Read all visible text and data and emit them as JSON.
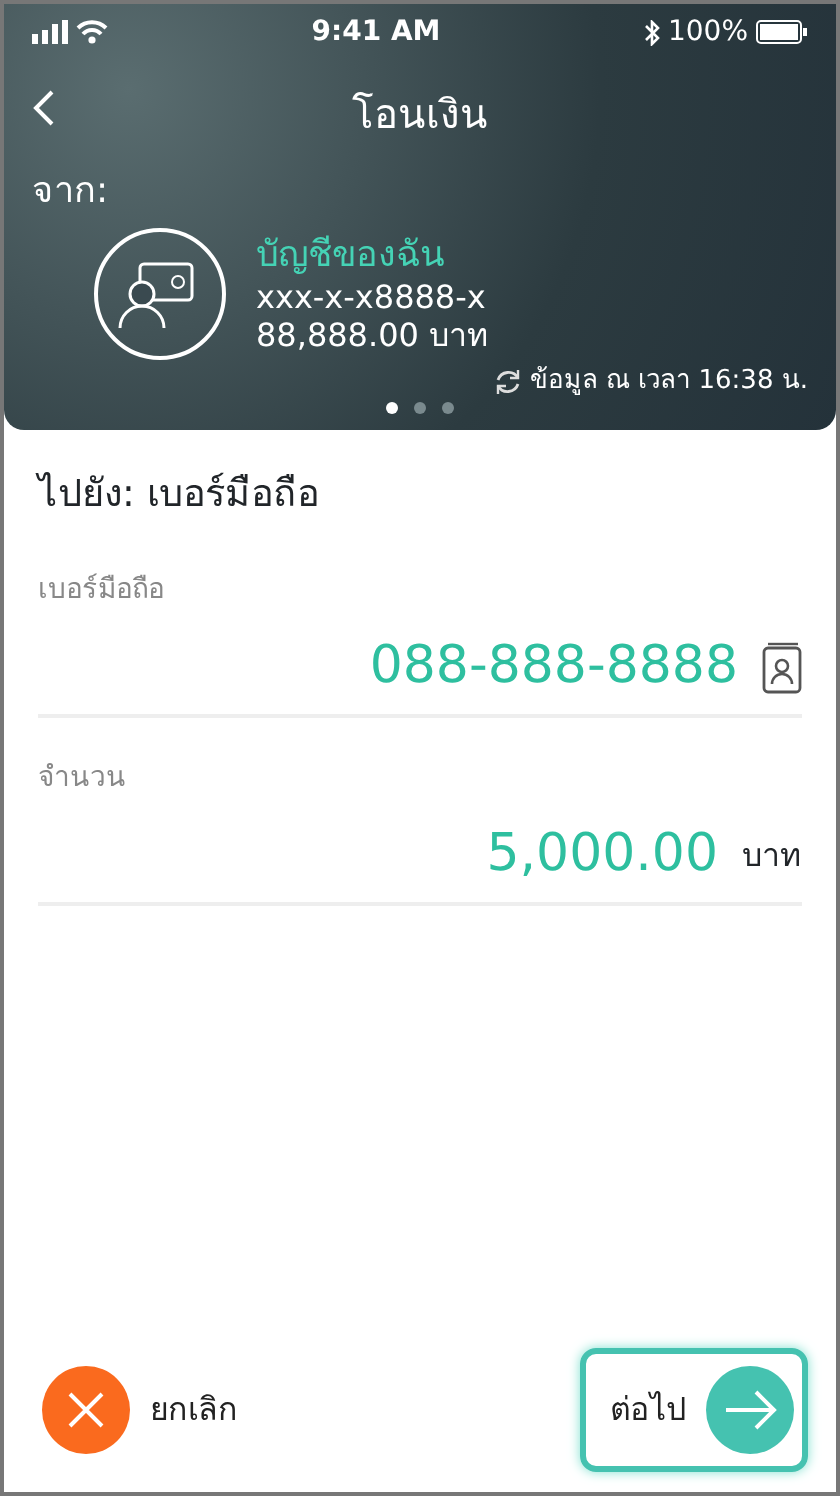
{
  "status_bar": {
    "time": "9:41 AM",
    "battery": "100%"
  },
  "header": {
    "title": "โอนเงิน"
  },
  "from": {
    "label": "จาก:",
    "account_name": "บัญชีของฉัน",
    "account_number": "xxx-x-x8888-x",
    "balance": "88,888.00 บาท",
    "updated": "ข้อมูล ณ เวลา 16:38 น.",
    "pages": [
      {
        "selected": true
      },
      {
        "selected": false
      },
      {
        "selected": false
      }
    ]
  },
  "to": {
    "label": "ไปยัง: เบอร์มือถือ"
  },
  "fields": [
    {
      "kind": "phone",
      "label": "เบอร์มือถือ",
      "value": "088-888-8888"
    },
    {
      "kind": "amount",
      "label": "จำนวน",
      "value": "5,000.00",
      "unit": "บาท"
    }
  ],
  "buttons": [
    {
      "kind": "cancel",
      "label": "ยกเลิก",
      "focused": false
    },
    {
      "kind": "next",
      "label": "ต่อไป",
      "focused": true
    }
  ]
}
